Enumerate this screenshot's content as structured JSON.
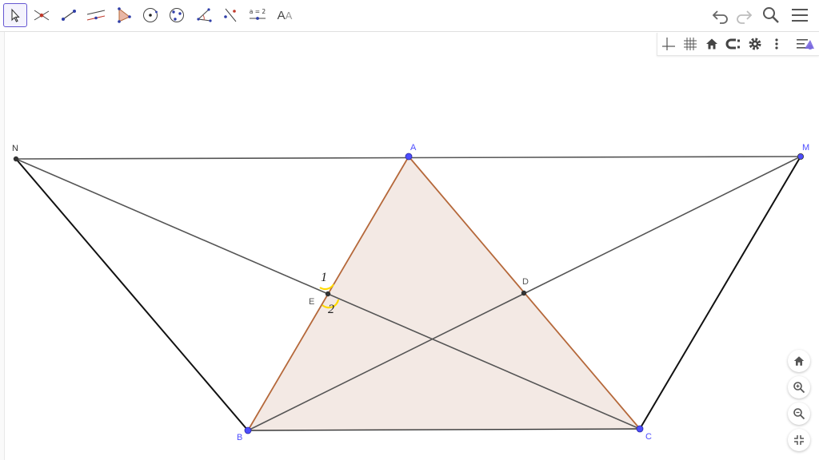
{
  "toolbar": {
    "tools": [
      {
        "name": "move-tool",
        "icon": "arrow-cursor-icon",
        "selected": true
      },
      {
        "name": "point-tool",
        "icon": "intersect-point-icon"
      },
      {
        "name": "segment-tool",
        "icon": "segment-icon"
      },
      {
        "name": "parallel-line-tool",
        "icon": "parallel-line-icon"
      },
      {
        "name": "polygon-tool",
        "icon": "polygon-icon"
      },
      {
        "name": "circle-tool",
        "icon": "circle-center-icon"
      },
      {
        "name": "circle-three-points-tool",
        "icon": "circle-three-points-icon"
      },
      {
        "name": "angle-tool",
        "icon": "angle-icon"
      },
      {
        "name": "reflect-tool",
        "icon": "reflect-icon"
      },
      {
        "name": "slider-tool",
        "icon": "slider-icon",
        "label": "a = 2"
      },
      {
        "name": "text-tool",
        "icon": "text-icon",
        "label": "AA"
      }
    ],
    "right": [
      "undo-icon",
      "redo-icon",
      "search-icon",
      "menu-icon"
    ]
  },
  "style_bar": [
    "axes-icon",
    "grid-icon",
    "home-icon",
    "point-capturing-icon",
    "gear-icon",
    "more-vert-icon",
    "algebra-view-toggle-icon"
  ],
  "points": {
    "N": "N",
    "A": "A",
    "M": "M",
    "B": "B",
    "C": "C",
    "D": "D",
    "E": "E"
  },
  "angles": {
    "angle1": "1",
    "angle2": "2"
  },
  "colors": {
    "accent": "#6557d2",
    "triangle_fill": "#f3e9e4",
    "triangle_edge": "#b5683a",
    "free_point": "#4d4dff",
    "dependent_point": "#333333",
    "angle_mark": "#ffd900"
  },
  "zoom_controls": [
    "home-icon",
    "zoom-in-icon",
    "zoom-out-icon",
    "exit-fullscreen-icon"
  ]
}
